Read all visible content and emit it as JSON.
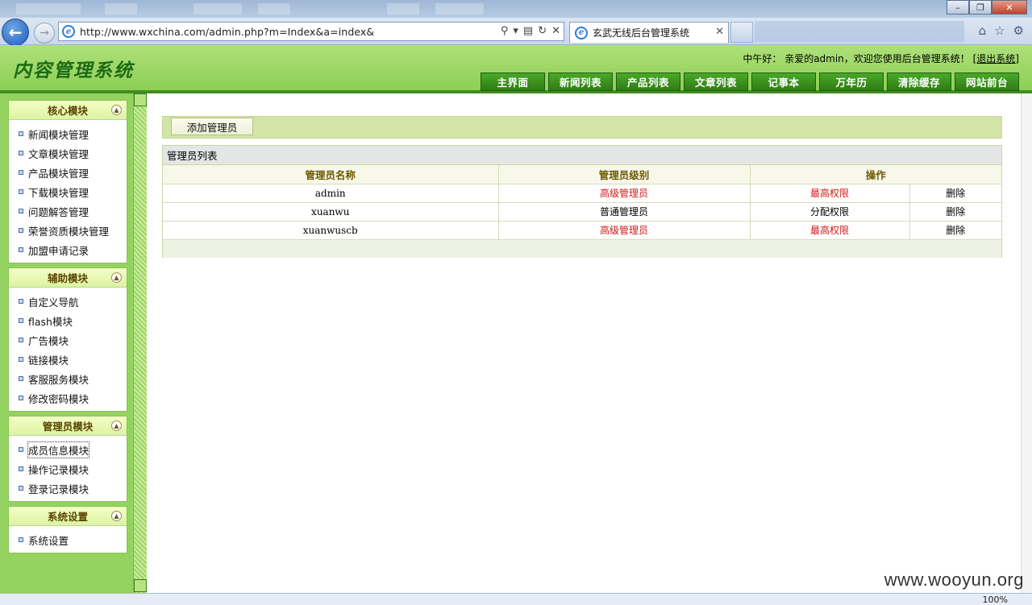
{
  "browser": {
    "url": "http://www.wxchina.com/admin.php?m=Index&a=index&",
    "tab_title": "玄武无线后台管理系统",
    "zoom": "100%"
  },
  "header": {
    "title": "内容管理系统",
    "greeting": "中午好：  亲爱的admin，欢迎您使用后台管理系统！",
    "logout": "[退出系统]",
    "nav": [
      "主界面",
      "新闻列表",
      "产品列表",
      "文章列表",
      "记事本",
      "万年历",
      "清除缓存",
      "网站前台"
    ]
  },
  "sidebar": {
    "sections": [
      {
        "title": "核心模块",
        "items": [
          "新闻模块管理",
          "文章模块管理",
          "产品模块管理",
          "下载模块管理",
          "问题解答管理",
          "荣誉资质模块管理",
          "加盟申请记录"
        ]
      },
      {
        "title": "辅助模块",
        "items": [
          "自定义导航",
          "flash模块",
          "广告模块",
          "链接模块",
          "客服服务模块",
          "修改密码模块"
        ]
      },
      {
        "title": "管理员模块",
        "items": [
          "成员信息模块",
          "操作记录模块",
          "登录记录模块"
        ]
      },
      {
        "title": "系统设置",
        "items": [
          "系统设置"
        ]
      }
    ]
  },
  "main": {
    "add_button": "添加管理员",
    "panel_title": "管理员列表",
    "columns": [
      "管理员名称",
      "管理员级别",
      "操作"
    ],
    "rows": [
      {
        "name": "admin",
        "level": "高级管理员",
        "perm": "最高权限",
        "action": "删除",
        "highlight": true
      },
      {
        "name": "xuanwu",
        "level": "普通管理员",
        "perm": "分配权限",
        "action": "删除",
        "highlight": false
      },
      {
        "name": "xuanwuscb",
        "level": "高级管理员",
        "perm": "最高权限",
        "action": "删除",
        "highlight": true
      }
    ]
  },
  "watermark": "www.wooyun.org",
  "colors": {
    "header_green": "#8dcf55",
    "nav_green": "#2e7d15",
    "danger_red": "#d01a1a"
  }
}
